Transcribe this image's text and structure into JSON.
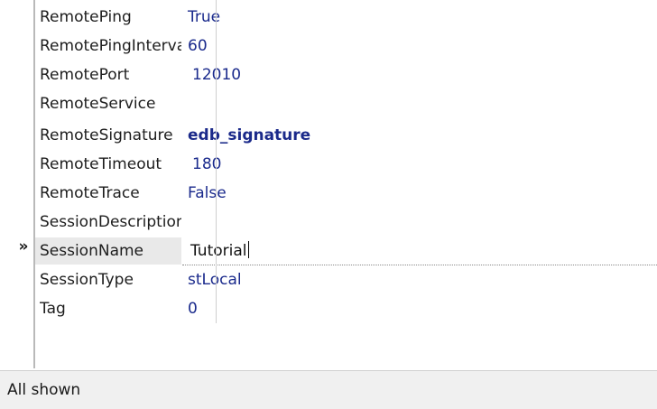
{
  "properties": [
    {
      "name": "RemotePing",
      "value": "True"
    },
    {
      "name": "RemotePingInterval",
      "value": "60"
    },
    {
      "name": "RemotePort",
      "value": "12010"
    },
    {
      "name": "RemoteService",
      "value": ""
    },
    {
      "name": "RemoteSignature",
      "value": "edb_signature"
    },
    {
      "name": "RemoteTimeout",
      "value": "180"
    },
    {
      "name": "RemoteTrace",
      "value": "False"
    },
    {
      "name": "SessionDescription",
      "value": ""
    },
    {
      "name": "SessionName",
      "value": "Tutorial"
    },
    {
      "name": "SessionType",
      "value": "stLocal"
    },
    {
      "name": "Tag",
      "value": "0"
    }
  ],
  "selected_indicator": "»",
  "status": {
    "text": "All shown"
  }
}
